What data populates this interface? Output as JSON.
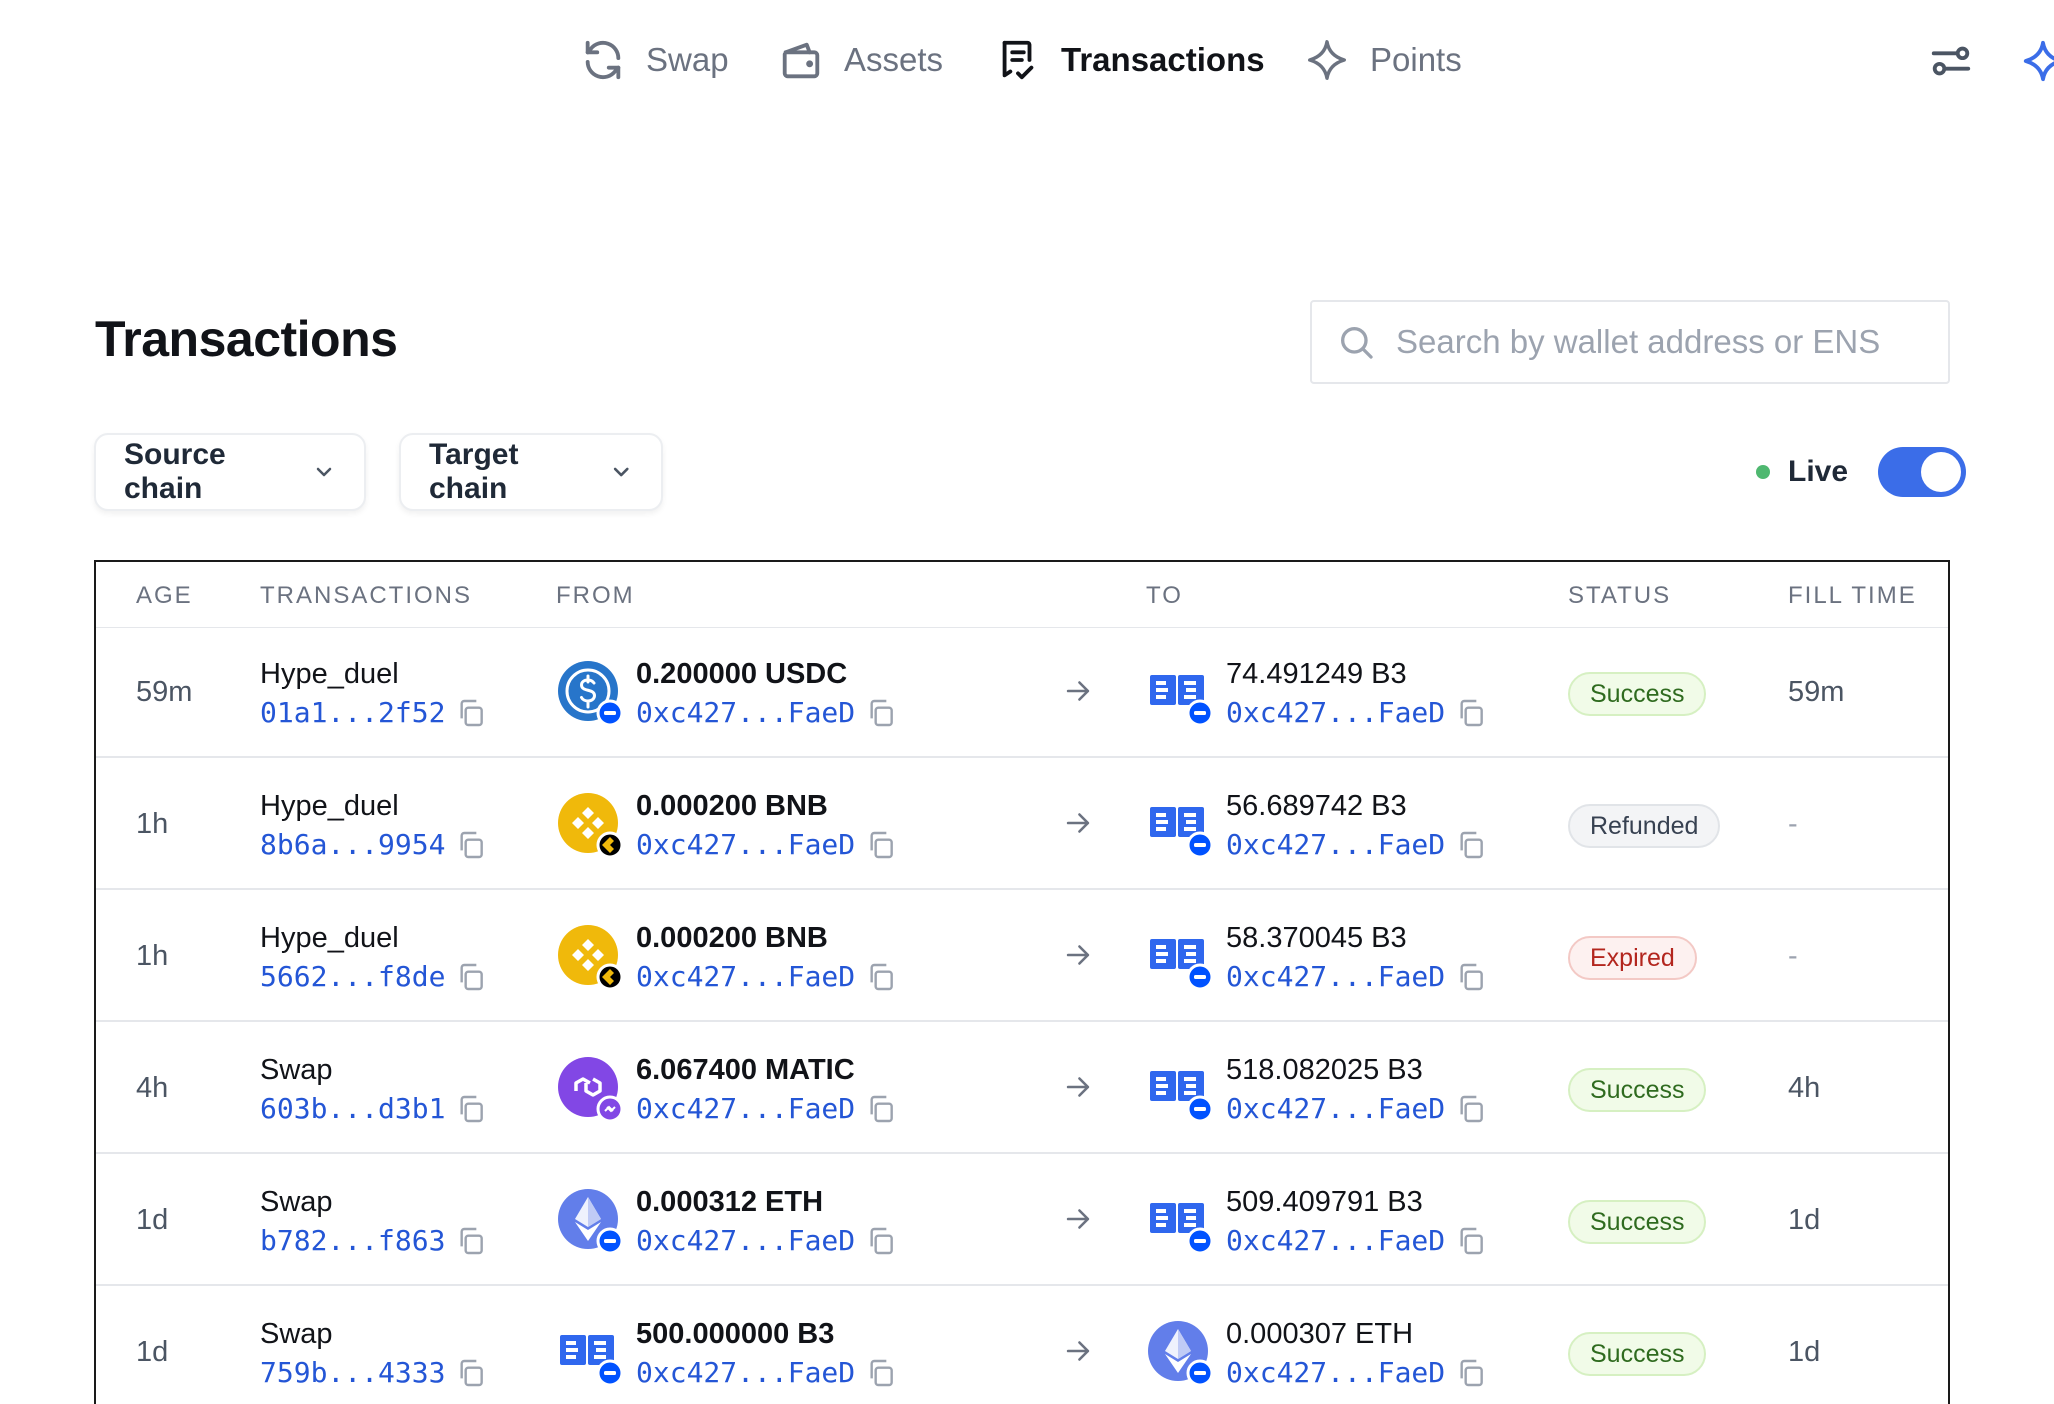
{
  "nav": {
    "items": [
      {
        "label": "Swap",
        "icon": "refresh-icon"
      },
      {
        "label": "Assets",
        "icon": "wallet-icon"
      },
      {
        "label": "Transactions",
        "icon": "receipt-icon",
        "active": true
      },
      {
        "label": "Points",
        "icon": "sparkle-icon"
      }
    ]
  },
  "page": {
    "title": "Transactions",
    "search_placeholder": "Search by wallet address or ENS"
  },
  "filters": {
    "source_label": "Source chain",
    "target_label": "Target chain",
    "live_label": "Live",
    "live_on": true
  },
  "table": {
    "headers": [
      "AGE",
      "TRANSACTIONS",
      "FROM",
      "TO",
      "STATUS",
      "FILL TIME"
    ],
    "rows": [
      {
        "age": "59m",
        "type": "Hype_duel",
        "hash": "01a1...2f52",
        "from_amount": "0.200000 USDC",
        "from_token": "usdc",
        "from_chain": "base",
        "from_addr": "0xc427...FaeD",
        "to_amount": "74.491249 B3",
        "to_token": "b3",
        "to_chain": "base",
        "to_addr": "0xc427...FaeD",
        "status": "Success",
        "fill": "59m"
      },
      {
        "age": "1h",
        "type": "Hype_duel",
        "hash": "8b6a...9954",
        "from_amount": "0.000200 BNB",
        "from_token": "bnb",
        "from_chain": "bnb",
        "from_addr": "0xc427...FaeD",
        "to_amount": "56.689742 B3",
        "to_token": "b3",
        "to_chain": "base",
        "to_addr": "0xc427...FaeD",
        "status": "Refunded",
        "fill": "-"
      },
      {
        "age": "1h",
        "type": "Hype_duel",
        "hash": "5662...f8de",
        "from_amount": "0.000200 BNB",
        "from_token": "bnb",
        "from_chain": "bnb",
        "from_addr": "0xc427...FaeD",
        "to_amount": "58.370045 B3",
        "to_token": "b3",
        "to_chain": "base",
        "to_addr": "0xc427...FaeD",
        "status": "Expired",
        "fill": "-"
      },
      {
        "age": "4h",
        "type": "Swap",
        "hash": "603b...d3b1",
        "from_amount": "6.067400 MATIC",
        "from_token": "matic",
        "from_chain": "polygon",
        "from_addr": "0xc427...FaeD",
        "to_amount": "518.082025 B3",
        "to_token": "b3",
        "to_chain": "base",
        "to_addr": "0xc427...FaeD",
        "status": "Success",
        "fill": "4h"
      },
      {
        "age": "1d",
        "type": "Swap",
        "hash": "b782...f863",
        "from_amount": "0.000312 ETH",
        "from_token": "eth",
        "from_chain": "base",
        "from_addr": "0xc427...FaeD",
        "to_amount": "509.409791 B3",
        "to_token": "b3",
        "to_chain": "base",
        "to_addr": "0xc427...FaeD",
        "status": "Success",
        "fill": "1d"
      },
      {
        "age": "1d",
        "type": "Swap",
        "hash": "759b...4333",
        "from_amount": "500.000000 B3",
        "from_token": "b3",
        "from_chain": "base",
        "from_addr": "0xc427...FaeD",
        "to_amount": "0.000307 ETH",
        "to_token": "eth",
        "to_chain": "base",
        "to_addr": "0xc427...FaeD",
        "status": "Success",
        "fill": "1d"
      }
    ]
  },
  "colors": {
    "accent": "#3b6de8",
    "link": "#2456d6",
    "live_dot": "#4fb870",
    "success_text": "#2f6b1f",
    "expired_text": "#b3261e"
  }
}
